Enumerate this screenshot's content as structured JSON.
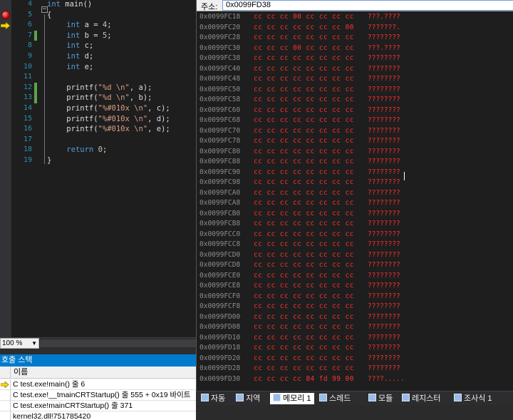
{
  "editor": {
    "lines": [
      {
        "num": "4",
        "code": [
          {
            "t": "int",
            "c": "kw"
          },
          {
            "t": " main()",
            "c": ""
          }
        ],
        "chg": false
      },
      {
        "num": "5",
        "code": [
          {
            "t": "{",
            "c": ""
          }
        ],
        "chg": false
      },
      {
        "num": "6",
        "code": [
          {
            "t": "    ",
            "c": ""
          },
          {
            "t": "int",
            "c": "kw"
          },
          {
            "t": " a = ",
            "c": ""
          },
          {
            "t": "4",
            "c": "num"
          },
          {
            "t": ";",
            "c": ""
          }
        ],
        "chg": false
      },
      {
        "num": "7",
        "code": [
          {
            "t": "    ",
            "c": ""
          },
          {
            "t": "int",
            "c": "kw"
          },
          {
            "t": " b = ",
            "c": ""
          },
          {
            "t": "5",
            "c": "num"
          },
          {
            "t": ";",
            "c": ""
          }
        ],
        "chg": true
      },
      {
        "num": "8",
        "code": [
          {
            "t": "    ",
            "c": ""
          },
          {
            "t": "int",
            "c": "kw"
          },
          {
            "t": " c;",
            "c": ""
          }
        ],
        "chg": false
      },
      {
        "num": "9",
        "code": [
          {
            "t": "    ",
            "c": ""
          },
          {
            "t": "int",
            "c": "kw"
          },
          {
            "t": " d;",
            "c": ""
          }
        ],
        "chg": false
      },
      {
        "num": "10",
        "code": [
          {
            "t": "    ",
            "c": ""
          },
          {
            "t": "int",
            "c": "kw"
          },
          {
            "t": " e;",
            "c": ""
          }
        ],
        "chg": false
      },
      {
        "num": "11",
        "code": [],
        "chg": false
      },
      {
        "num": "12",
        "code": [
          {
            "t": "    printf(",
            "c": ""
          },
          {
            "t": "\"%d \\n\"",
            "c": "str"
          },
          {
            "t": ", a);",
            "c": ""
          }
        ],
        "chg": true
      },
      {
        "num": "13",
        "code": [
          {
            "t": "    printf(",
            "c": ""
          },
          {
            "t": "\"%d \\n\"",
            "c": "str"
          },
          {
            "t": ", b);",
            "c": ""
          }
        ],
        "chg": true
      },
      {
        "num": "14",
        "code": [
          {
            "t": "    printf(",
            "c": ""
          },
          {
            "t": "\"%#010x \\n\"",
            "c": "str"
          },
          {
            "t": ", c);",
            "c": ""
          }
        ],
        "chg": false
      },
      {
        "num": "15",
        "code": [
          {
            "t": "    printf(",
            "c": ""
          },
          {
            "t": "\"%#010x \\n\"",
            "c": "str"
          },
          {
            "t": ", d);",
            "c": ""
          }
        ],
        "chg": false
      },
      {
        "num": "16",
        "code": [
          {
            "t": "    printf(",
            "c": ""
          },
          {
            "t": "\"%#010x \\n\"",
            "c": "str"
          },
          {
            "t": ", e);",
            "c": ""
          }
        ],
        "chg": false
      },
      {
        "num": "17",
        "code": [],
        "chg": false
      },
      {
        "num": "18",
        "code": [
          {
            "t": "    ",
            "c": ""
          },
          {
            "t": "return",
            "c": "kw"
          },
          {
            "t": " ",
            "c": ""
          },
          {
            "t": "0",
            "c": "num"
          },
          {
            "t": ";",
            "c": ""
          }
        ],
        "chg": false
      },
      {
        "num": "19",
        "code": [
          {
            "t": "}",
            "c": ""
          }
        ],
        "chg": false
      }
    ],
    "breakpoint_line_index": 1,
    "current_line_index": 2,
    "zoom": "100 %"
  },
  "memory": {
    "address_label": "주소:",
    "address_value": "0x0099FD38",
    "rows": [
      {
        "addr": "0x0099FC18",
        "bytes": "cc cc cc 00 cc cc cc cc",
        "ascii": "???.????"
      },
      {
        "addr": "0x0099FC20",
        "bytes": "cc cc cc cc cc cc cc 00",
        "ascii": "???????."
      },
      {
        "addr": "0x0099FC28",
        "bytes": "cc cc cc cc cc cc cc cc",
        "ascii": "????????"
      },
      {
        "addr": "0x0099FC30",
        "bytes": "cc cc cc 00 cc cc cc cc",
        "ascii": "???.????"
      },
      {
        "addr": "0x0099FC38",
        "bytes": "cc cc cc cc cc cc cc cc",
        "ascii": "????????"
      },
      {
        "addr": "0x0099FC40",
        "bytes": "cc cc cc cc cc cc cc cc",
        "ascii": "????????"
      },
      {
        "addr": "0x0099FC48",
        "bytes": "cc cc cc cc cc cc cc cc",
        "ascii": "????????"
      },
      {
        "addr": "0x0099FC50",
        "bytes": "cc cc cc cc cc cc cc cc",
        "ascii": "????????"
      },
      {
        "addr": "0x0099FC58",
        "bytes": "cc cc cc cc cc cc cc cc",
        "ascii": "????????"
      },
      {
        "addr": "0x0099FC60",
        "bytes": "cc cc cc cc cc cc cc cc",
        "ascii": "????????"
      },
      {
        "addr": "0x0099FC68",
        "bytes": "cc cc cc cc cc cc cc cc",
        "ascii": "????????"
      },
      {
        "addr": "0x0099FC70",
        "bytes": "cc cc cc cc cc cc cc cc",
        "ascii": "????????"
      },
      {
        "addr": "0x0099FC78",
        "bytes": "cc cc cc cc cc cc cc cc",
        "ascii": "????????"
      },
      {
        "addr": "0x0099FC80",
        "bytes": "cc cc cc cc cc cc cc cc",
        "ascii": "????????"
      },
      {
        "addr": "0x0099FC88",
        "bytes": "cc cc cc cc cc cc cc cc",
        "ascii": "????????"
      },
      {
        "addr": "0x0099FC90",
        "bytes": "cc cc cc cc cc cc cc cc",
        "ascii": "????????"
      },
      {
        "addr": "0x0099FC98",
        "bytes": "cc cc cc cc cc cc cc cc",
        "ascii": "????????"
      },
      {
        "addr": "0x0099FCA0",
        "bytes": "cc cc cc cc cc cc cc cc",
        "ascii": "????????"
      },
      {
        "addr": "0x0099FCA8",
        "bytes": "cc cc cc cc cc cc cc cc",
        "ascii": "????????"
      },
      {
        "addr": "0x0099FCB0",
        "bytes": "cc cc cc cc cc cc cc cc",
        "ascii": "????????"
      },
      {
        "addr": "0x0099FCB8",
        "bytes": "cc cc cc cc cc cc cc cc",
        "ascii": "????????"
      },
      {
        "addr": "0x0099FCC0",
        "bytes": "cc cc cc cc cc cc cc cc",
        "ascii": "????????"
      },
      {
        "addr": "0x0099FCC8",
        "bytes": "cc cc cc cc cc cc cc cc",
        "ascii": "????????"
      },
      {
        "addr": "0x0099FCD0",
        "bytes": "cc cc cc cc cc cc cc cc",
        "ascii": "????????"
      },
      {
        "addr": "0x0099FCD8",
        "bytes": "cc cc cc cc cc cc cc cc",
        "ascii": "????????"
      },
      {
        "addr": "0x0099FCE0",
        "bytes": "cc cc cc cc cc cc cc cc",
        "ascii": "????????"
      },
      {
        "addr": "0x0099FCE8",
        "bytes": "cc cc cc cc cc cc cc cc",
        "ascii": "????????"
      },
      {
        "addr": "0x0099FCF0",
        "bytes": "cc cc cc cc cc cc cc cc",
        "ascii": "????????"
      },
      {
        "addr": "0x0099FCF8",
        "bytes": "cc cc cc cc cc cc cc cc",
        "ascii": "????????"
      },
      {
        "addr": "0x0099FD00",
        "bytes": "cc cc cc cc cc cc cc cc",
        "ascii": "????????"
      },
      {
        "addr": "0x0099FD08",
        "bytes": "cc cc cc cc cc cc cc cc",
        "ascii": "????????"
      },
      {
        "addr": "0x0099FD10",
        "bytes": "cc cc cc cc cc cc cc cc",
        "ascii": "????????"
      },
      {
        "addr": "0x0099FD18",
        "bytes": "cc cc cc cc cc cc cc cc",
        "ascii": "????????"
      },
      {
        "addr": "0x0099FD20",
        "bytes": "cc cc cc cc cc cc cc cc",
        "ascii": "????????"
      },
      {
        "addr": "0x0099FD28",
        "bytes": "cc cc cc cc cc cc cc cc",
        "ascii": "????????"
      },
      {
        "addr": "0x0099FD30",
        "bytes": "cc cc cc cc 84 fd 99 00",
        "ascii": "????....."
      }
    ]
  },
  "tabs": [
    {
      "label": "자동",
      "icon": "autos-icon"
    },
    {
      "label": "지역",
      "icon": "locals-icon"
    },
    {
      "label": "메모리 1",
      "icon": "memory-icon"
    },
    {
      "label": "스레드",
      "icon": "threads-icon"
    },
    {
      "label": "모듈",
      "icon": "modules-icon"
    },
    {
      "label": "레지스터",
      "icon": "registers-icon"
    },
    {
      "label": "조사식 1",
      "icon": "watch-icon"
    }
  ],
  "callstack": {
    "title": "호출 스택",
    "column_header": "이름",
    "rows": [
      {
        "text": "C test.exe!main()  줄 6",
        "current": true
      },
      {
        "text": "C test.exe!__tmainCRTStartup()  줄 555 + 0x19 바이트",
        "current": false
      },
      {
        "text": "C test.exe!mainCRTStartup()  줄 371",
        "current": false
      },
      {
        "text": "kernel32.dll!751785420",
        "current": false
      }
    ]
  }
}
